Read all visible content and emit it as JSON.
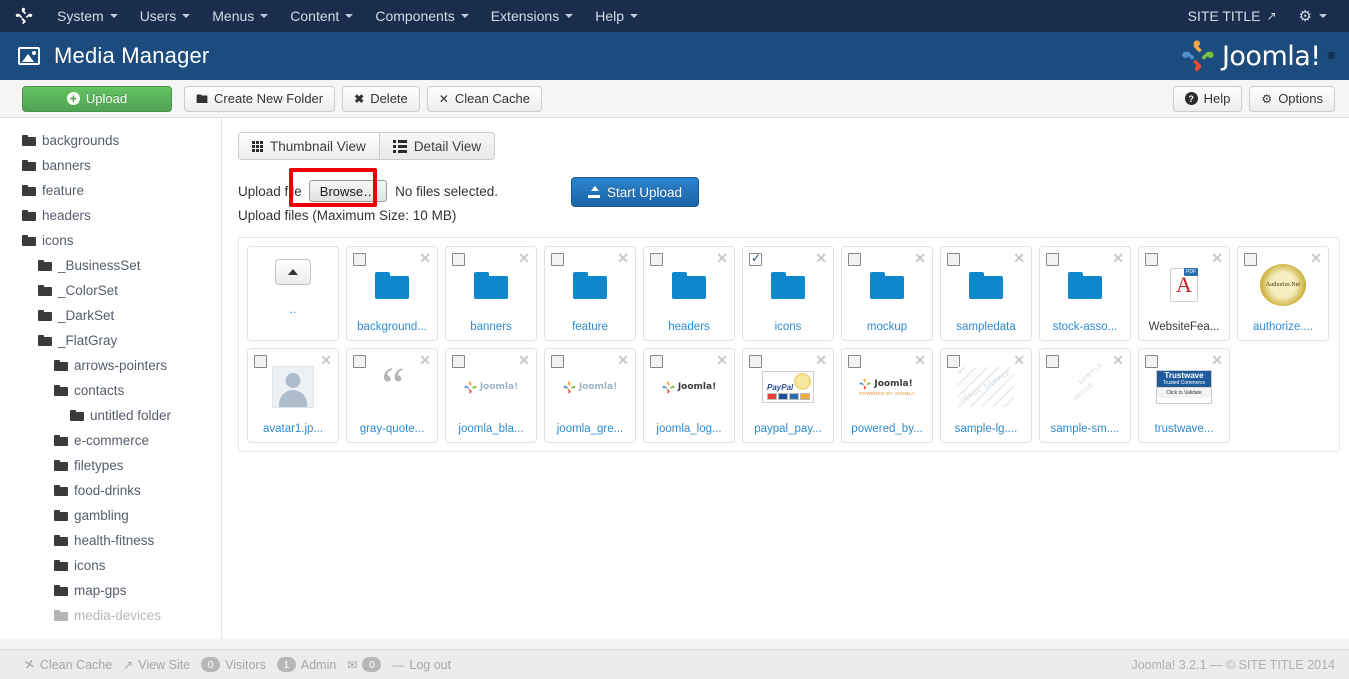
{
  "topbar": {
    "brand_icon": "joomla-mark-icon",
    "menu": [
      {
        "label": "System",
        "icon": "chevron-down-icon"
      },
      {
        "label": "Users",
        "icon": "chevron-down-icon"
      },
      {
        "label": "Menus",
        "icon": "chevron-down-icon"
      },
      {
        "label": "Content",
        "icon": "chevron-down-icon"
      },
      {
        "label": "Components",
        "icon": "chevron-down-icon"
      },
      {
        "label": "Extensions",
        "icon": "chevron-down-icon"
      },
      {
        "label": "Help",
        "icon": "chevron-down-icon"
      }
    ],
    "site_title": "SITE TITLE",
    "site_title_icon": "external-link-icon",
    "gear_icon": "gear-icon",
    "background": "#1a2d4d"
  },
  "pageheader": {
    "icon": "picture-icon",
    "title": "Media Manager",
    "logo_text": "Joomla!",
    "logo_registered": "®",
    "background": "#1c4c7e"
  },
  "toolbar": {
    "upload_label": "Upload",
    "upload_icon": "plus-circle-icon",
    "create_folder_label": "Create New Folder",
    "create_folder_icon": "folder-icon",
    "delete_label": "Delete",
    "delete_icon": "x-icon",
    "clean_cache_label": "Clean Cache",
    "clean_cache_icon": "broom-icon",
    "help_label": "Help",
    "help_icon": "question-circle-icon",
    "options_label": "Options",
    "options_icon": "gear-icon",
    "upload_color": "#51a351"
  },
  "sidebar": {
    "items": [
      {
        "label": "backgrounds",
        "indent": 0,
        "faded": false
      },
      {
        "label": "banners",
        "indent": 0,
        "faded": false
      },
      {
        "label": "feature",
        "indent": 0,
        "faded": false
      },
      {
        "label": "headers",
        "indent": 0,
        "faded": false
      },
      {
        "label": "icons",
        "indent": 0,
        "faded": false
      },
      {
        "label": "_BusinessSet",
        "indent": 1,
        "faded": false
      },
      {
        "label": "_ColorSet",
        "indent": 1,
        "faded": false
      },
      {
        "label": "_DarkSet",
        "indent": 1,
        "faded": false
      },
      {
        "label": "_FlatGray",
        "indent": 1,
        "faded": false
      },
      {
        "label": "arrows-pointers",
        "indent": 2,
        "faded": false
      },
      {
        "label": "contacts",
        "indent": 2,
        "faded": false
      },
      {
        "label": "untitled folder",
        "indent": 3,
        "faded": false
      },
      {
        "label": "e-commerce",
        "indent": 2,
        "faded": false
      },
      {
        "label": "filetypes",
        "indent": 2,
        "faded": false
      },
      {
        "label": "food-drinks",
        "indent": 2,
        "faded": false
      },
      {
        "label": "gambling",
        "indent": 2,
        "faded": false
      },
      {
        "label": "health-fitness",
        "indent": 2,
        "faded": false
      },
      {
        "label": "icons",
        "indent": 2,
        "faded": false
      },
      {
        "label": "map-gps",
        "indent": 2,
        "faded": false
      },
      {
        "label": "media-devices",
        "indent": 2,
        "faded": true
      }
    ]
  },
  "view_tabs": [
    {
      "label": "Thumbnail View",
      "icon": "grid-icon",
      "active": true
    },
    {
      "label": "Detail View",
      "icon": "list-icon",
      "active": false
    }
  ],
  "upload": {
    "file_label": "Upload file",
    "browse_label": "Browse…",
    "no_files_text": "No files selected.",
    "max_size_text": "Upload files (Maximum Size: 10 MB)",
    "start_upload_label": "Start Upload",
    "start_upload_icon": "upload-icon",
    "highlight_color": "#ee0000"
  },
  "files": [
    {
      "name": "..",
      "type": "updir",
      "checked": false,
      "close": false
    },
    {
      "name": "background...",
      "type": "folder",
      "checked": false,
      "close": true
    },
    {
      "name": "banners",
      "type": "folder",
      "checked": false,
      "close": true
    },
    {
      "name": "feature",
      "type": "folder",
      "checked": false,
      "close": true
    },
    {
      "name": "headers",
      "type": "folder",
      "checked": false,
      "close": true
    },
    {
      "name": "icons",
      "type": "folder",
      "checked": true,
      "close": true
    },
    {
      "name": "mockup",
      "type": "folder",
      "checked": false,
      "close": true
    },
    {
      "name": "sampledata",
      "type": "folder",
      "checked": false,
      "close": true
    },
    {
      "name": "stock-asso...",
      "type": "folder",
      "checked": false,
      "close": true
    },
    {
      "name": "WebsiteFea...",
      "type": "pdf",
      "checked": false,
      "close": true
    },
    {
      "name": "authorize....",
      "type": "authorize",
      "checked": false,
      "close": true
    },
    {
      "name": "avatar1.jp...",
      "type": "avatar",
      "checked": false,
      "close": true
    },
    {
      "name": "gray-quote...",
      "type": "quote",
      "checked": false,
      "close": true
    },
    {
      "name": "joomla_bla...",
      "type": "joomla-faint",
      "checked": false,
      "close": true
    },
    {
      "name": "joomla_gre...",
      "type": "joomla-faint",
      "checked": false,
      "close": true
    },
    {
      "name": "joomla_log...",
      "type": "joomla",
      "checked": false,
      "close": true
    },
    {
      "name": "paypal_pay...",
      "type": "paypal",
      "checked": false,
      "close": true
    },
    {
      "name": "powered_by...",
      "type": "powered",
      "checked": false,
      "close": true
    },
    {
      "name": "sample-lg....",
      "type": "sample-lg",
      "checked": false,
      "close": true
    },
    {
      "name": "sample-sm....",
      "type": "sample-sm",
      "checked": false,
      "close": true
    },
    {
      "name": "trustwave...",
      "type": "trustwave",
      "checked": false,
      "close": true
    }
  ],
  "thumb_labels": {
    "joomla_word": "Joomla!",
    "powered_sub": "POWERED BY JOOMLA",
    "authorize_text": "Authorize.Net",
    "paypal_word": "PayPal",
    "sample_lg_text": "IMAGE SAMPLE",
    "sample_sm_text_a": "SAMPLE",
    "sample_sm_text_b": "IMAGE",
    "trustwave_title": "Trustwave",
    "trustwave_sub": "Trusted Commerce",
    "trustwave_action": "Click to Validate"
  },
  "statusbar": {
    "clean_cache": "Clean Cache",
    "clean_cache_icon": "broom-icon",
    "view_site": "View Site",
    "view_site_icon": "external-link-icon",
    "visitors_count": "0",
    "visitors_label": "Visitors",
    "admin_count": "1",
    "admin_label": "Admin",
    "mail_icon": "envelope-icon",
    "messages_count": "0",
    "dash_icon": "dash-icon",
    "logout_label": "Log out",
    "copyright": "Joomla! 3.2.1 — © SITE TITLE 2014"
  }
}
